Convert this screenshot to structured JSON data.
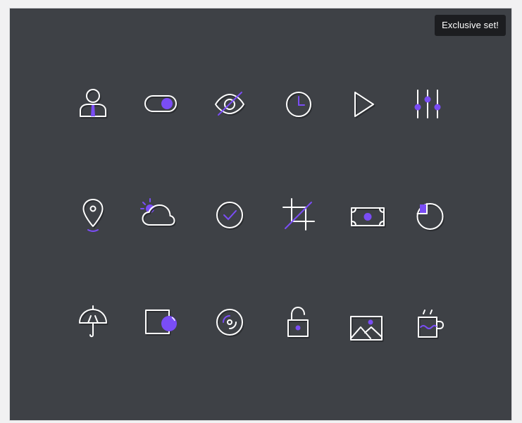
{
  "badge": {
    "label": "Exclusive set!"
  },
  "colors": {
    "background": "#3e4146",
    "accent": "#7a4df5",
    "stroke": "#ffffff",
    "badge": "#1c1d20"
  },
  "icons": [
    {
      "row": 1,
      "name": "user-icon"
    },
    {
      "row": 1,
      "name": "toggle-icon"
    },
    {
      "row": 1,
      "name": "eye-slash-icon"
    },
    {
      "row": 1,
      "name": "clock-icon"
    },
    {
      "row": 1,
      "name": "play-icon"
    },
    {
      "row": 1,
      "name": "sliders-icon"
    },
    {
      "row": 2,
      "name": "map-pin-icon"
    },
    {
      "row": 2,
      "name": "weather-cloud-sun-icon"
    },
    {
      "row": 2,
      "name": "check-circle-icon"
    },
    {
      "row": 2,
      "name": "crop-icon"
    },
    {
      "row": 2,
      "name": "money-icon"
    },
    {
      "row": 2,
      "name": "pie-chart-icon"
    },
    {
      "row": 3,
      "name": "umbrella-icon"
    },
    {
      "row": 3,
      "name": "layers-icon"
    },
    {
      "row": 3,
      "name": "disc-icon"
    },
    {
      "row": 3,
      "name": "unlock-icon"
    },
    {
      "row": 3,
      "name": "image-icon"
    },
    {
      "row": 3,
      "name": "mug-icon"
    }
  ]
}
